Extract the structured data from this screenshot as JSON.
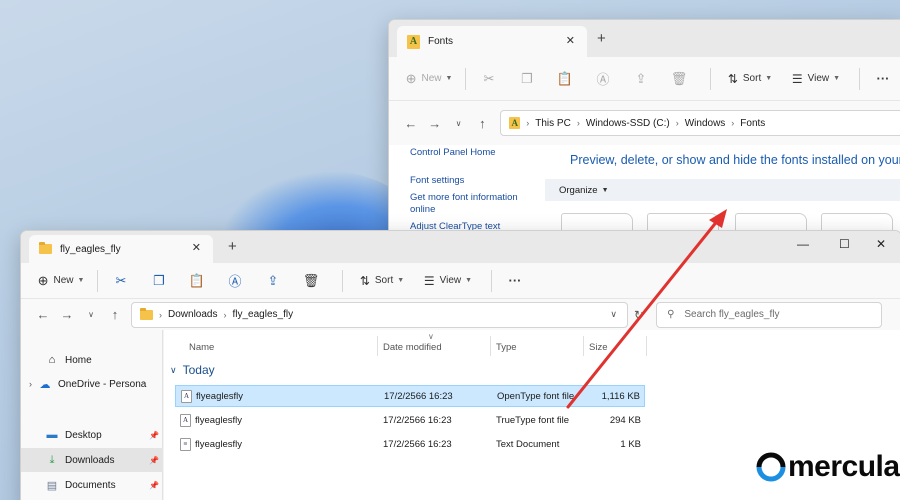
{
  "fonts_window": {
    "tab_title": "Fonts",
    "toolbar": {
      "new_label": "New",
      "sort_label": "Sort",
      "view_label": "View"
    },
    "breadcrumb": [
      "This PC",
      "Windows-SSD (C:)",
      "Windows",
      "Fonts"
    ],
    "sidebar_links": [
      "Control Panel Home",
      "Font settings",
      "Get more font information online",
      "Adjust ClearType text"
    ],
    "heading": "Preview, delete, or show and hide the fonts installed on your c",
    "organize_label": "Organize"
  },
  "downloads_window": {
    "tab_title": "fly_eagles_fly",
    "toolbar": {
      "new_label": "New",
      "sort_label": "Sort",
      "view_label": "View"
    },
    "breadcrumb": [
      "Downloads",
      "fly_eagles_fly"
    ],
    "search_placeholder": "Search fly_eagles_fly",
    "sidebar": [
      {
        "label": "Home",
        "icon": "home-icon"
      },
      {
        "label": "OneDrive - Persona",
        "icon": "cloud-icon"
      },
      {
        "label": "Desktop",
        "icon": "desktop-icon"
      },
      {
        "label": "Downloads",
        "icon": "download-icon"
      },
      {
        "label": "Documents",
        "icon": "documents-icon"
      }
    ],
    "columns": [
      "Name",
      "Date modified",
      "Type",
      "Size"
    ],
    "group_label": "Today",
    "files": [
      {
        "name": "flyeaglesfly",
        "date": "17/2/2566 16:23",
        "type": "OpenType font file",
        "size": "1,116 KB",
        "icon": "font-file-icon"
      },
      {
        "name": "flyeaglesfly",
        "date": "17/2/2566 16:23",
        "type": "TrueType font file",
        "size": "294 KB",
        "icon": "font-file-icon"
      },
      {
        "name": "flyeaglesfly",
        "date": "17/2/2566 16:23",
        "type": "Text Document",
        "size": "1 KB",
        "icon": "text-file-icon"
      }
    ]
  },
  "branding": {
    "logo_text": "mercular."
  },
  "colors": {
    "arrow": "#e0322e",
    "selection": "#cce8ff",
    "link": "#1a4ea0"
  }
}
